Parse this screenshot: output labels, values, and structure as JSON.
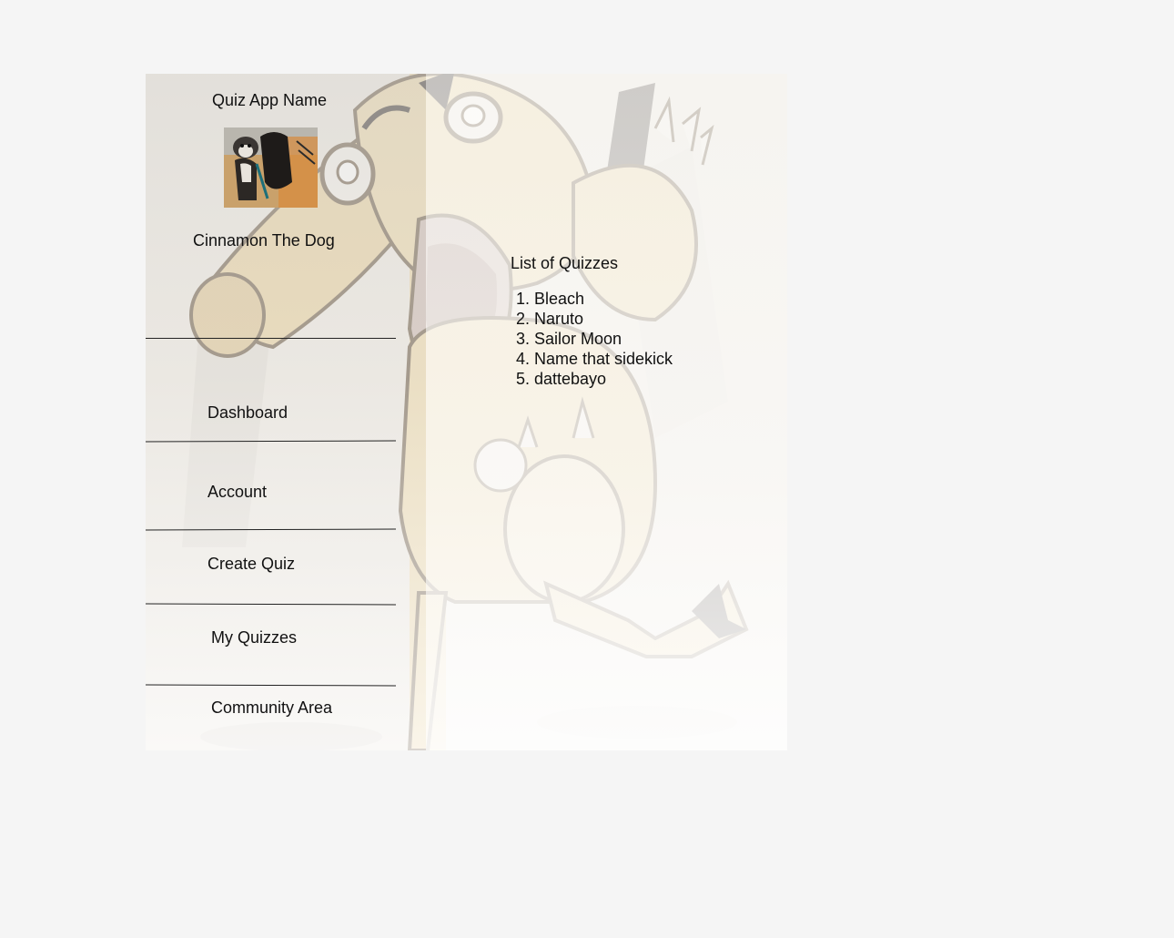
{
  "sidebar": {
    "app_name": "Quiz App Name",
    "user_name": "Cinnamon The Dog",
    "nav": [
      {
        "label": "Dashboard"
      },
      {
        "label": "Account"
      },
      {
        "label": "Create Quiz"
      },
      {
        "label": "My Quizzes"
      },
      {
        "label": "Community Area"
      }
    ]
  },
  "main": {
    "title": "List of Quizzes",
    "quizzes": [
      "Bleach",
      "Naruto",
      "Sailor Moon",
      "Name that sidekick",
      "dattebayo"
    ]
  },
  "colors": {
    "page_background": "#f5f5f5",
    "mascot_fill": "#e9d2a2",
    "mascot_outline": "#6b5a45",
    "text": "#111111"
  },
  "icons": {
    "avatar": "dog-photo",
    "background": "cartoon-mascot"
  }
}
